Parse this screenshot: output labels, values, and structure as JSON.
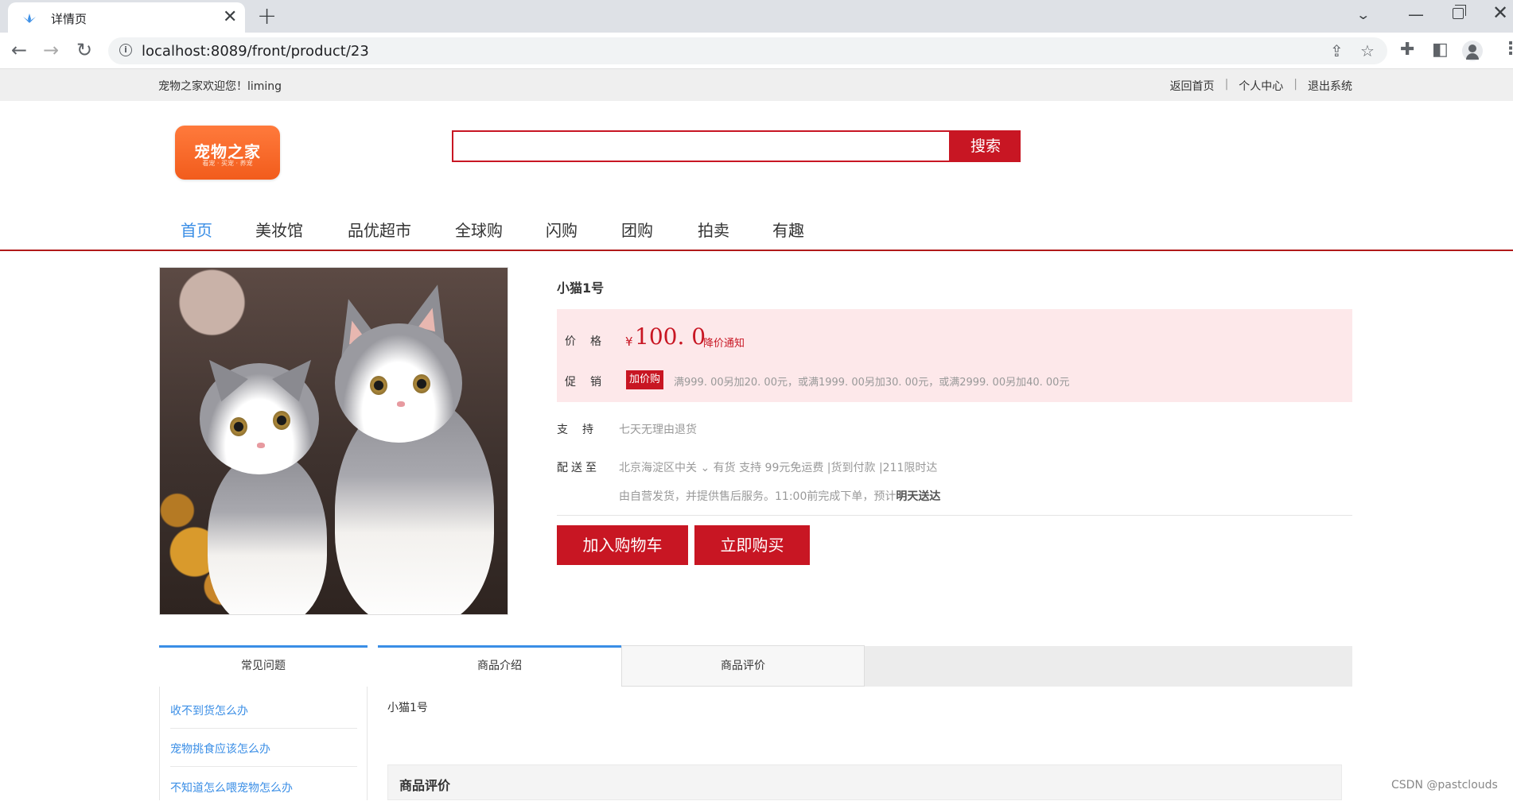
{
  "browser": {
    "tab_title": "详情页",
    "tab_close": "✕",
    "new_tab": "+",
    "url": "localhost:8089/front/product/23",
    "tab_search_icon": "chevron-down",
    "window_controls": {
      "minimize": "—",
      "close": "✕"
    }
  },
  "site": {
    "welcome": "宠物之家欢迎您！liming",
    "top_links": [
      "返回首页",
      "个人中心",
      "退出系统"
    ],
    "logo": {
      "text": "宠物之家",
      "sub": "看宠 · 买宠 · 养宠"
    },
    "search": {
      "placeholder": "",
      "button": "搜索"
    },
    "nav": [
      "首页",
      "美妆馆",
      "品优超市",
      "全球购",
      "闪购",
      "团购",
      "拍卖",
      "有趣"
    ],
    "nav_active": 0
  },
  "product": {
    "title": "小猫1号",
    "price_label": "价格",
    "currency": "¥",
    "price": "100. 0",
    "price_notice": "降价通知",
    "promo_label": "促销",
    "promo_tag": "加价购",
    "promo_text": "满999. 00另加20. 00元，或满1999. 00另加30. 00元，或满2999. 00另加40. 00元",
    "support_label": "支持",
    "support_value": "七天无理由退货",
    "deliver_label": "配送至",
    "deliver_value": "北京海淀区中关 ⌄ 有货  支持  99元免运费 |货到付款 |211限时达",
    "deliver_note_prefix": "由自营发货，并提供售后服务。11:00前完成下单，预计",
    "deliver_note_bold": "明天送达",
    "add_cart": "加入购物车",
    "buy_now": "立即购买"
  },
  "bottom": {
    "faq_title": "常见问题",
    "faq_items": [
      "收不到货怎么办",
      "宠物挑食应该怎么办",
      "不知道怎么喂宠物怎么办"
    ],
    "tabs": [
      "商品介绍",
      "商品评价"
    ],
    "intro_text": "小猫1号",
    "review_title": "商品评价"
  },
  "watermark": "CSDN @pastclouds",
  "colors": {
    "brand_red": "#c81623",
    "link_blue": "#3a8ee6",
    "promo_bg": "#fde8ea"
  }
}
